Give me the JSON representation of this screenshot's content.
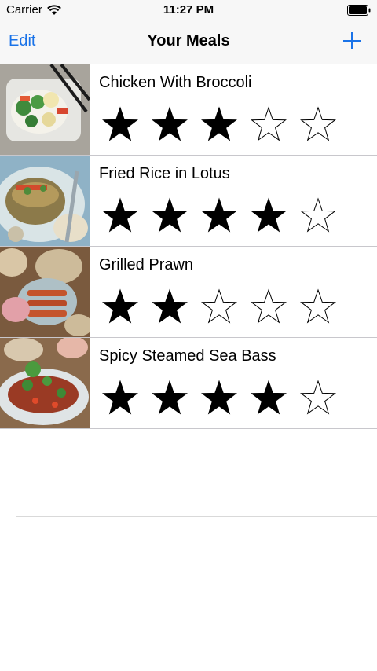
{
  "status_bar": {
    "carrier": "Carrier",
    "time": "11:27 PM",
    "icons": [
      "wifi-icon",
      "battery-icon"
    ]
  },
  "nav_bar": {
    "edit_label": "Edit",
    "title": "Your Meals",
    "add_icon": "plus-icon",
    "accent_color": "#1a73e8"
  },
  "meals": [
    {
      "name": "Chicken With Broccoli",
      "rating": 3,
      "max_rating": 5
    },
    {
      "name": "Fried Rice in Lotus",
      "rating": 4,
      "max_rating": 5
    },
    {
      "name": "Grilled Prawn",
      "rating": 2,
      "max_rating": 5
    },
    {
      "name": "Spicy Steamed Sea Bass",
      "rating": 4,
      "max_rating": 5
    }
  ]
}
